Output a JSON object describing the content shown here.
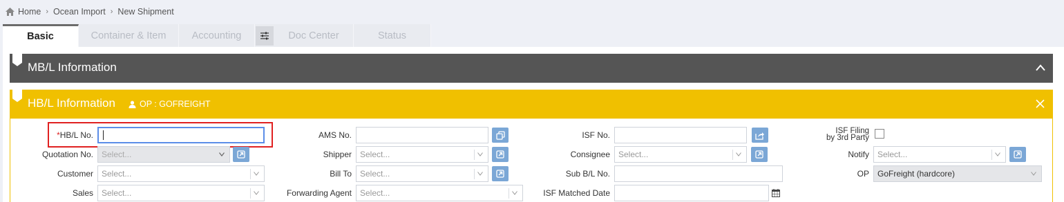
{
  "breadcrumb": {
    "home": "Home",
    "section": "Ocean Import",
    "page": "New Shipment"
  },
  "tabs": [
    {
      "label": "Basic"
    },
    {
      "label": "Container & Item"
    },
    {
      "label": "Accounting"
    },
    {
      "label": "Doc Center"
    },
    {
      "label": "Status"
    }
  ],
  "mbl_panel": {
    "title": "MB/L Information"
  },
  "hbl_panel": {
    "title": "HB/L Information",
    "op_badge": "OP : GOFREIGHT"
  },
  "form": {
    "hbl_no": {
      "required_mark": "*",
      "label": "HB/L No.",
      "value": ""
    },
    "quotation_no": {
      "label": "Quotation No.",
      "placeholder": "Select..."
    },
    "customer": {
      "label": "Customer",
      "placeholder": "Select..."
    },
    "sales": {
      "label": "Sales",
      "placeholder": "Select..."
    },
    "ams_no": {
      "label": "AMS No.",
      "value": ""
    },
    "shipper": {
      "label": "Shipper",
      "placeholder": "Select..."
    },
    "bill_to": {
      "label": "Bill To",
      "placeholder": "Select..."
    },
    "forwarding_agent": {
      "label": "Forwarding Agent",
      "placeholder": "Select..."
    },
    "isf_no": {
      "label": "ISF No.",
      "value": ""
    },
    "consignee": {
      "label": "Consignee",
      "placeholder": "Select..."
    },
    "sub_bl_no": {
      "label": "Sub B/L No.",
      "value": ""
    },
    "isf_matched_date": {
      "label": "ISF Matched Date",
      "value": ""
    },
    "isf_filing": {
      "label_line1": "ISF Filing",
      "label_line2": "by 3rd Party",
      "checked": false
    },
    "notify": {
      "label": "Notify",
      "placeholder": "Select..."
    },
    "op": {
      "label": "OP",
      "value": "GoFreight (hardcore)"
    }
  },
  "colors": {
    "mbl_header": "#555555",
    "hbl_header": "#f0c000",
    "action_button": "#7ba7d6",
    "highlight": "#e02020"
  }
}
